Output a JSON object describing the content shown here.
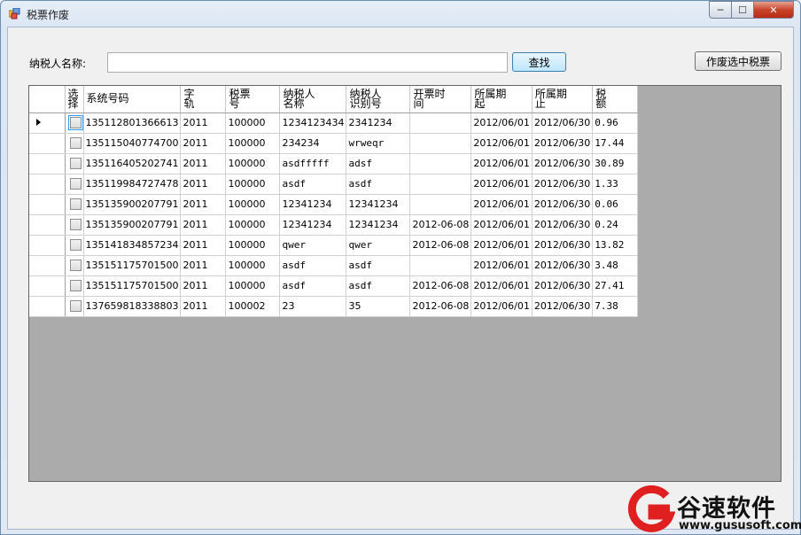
{
  "window": {
    "title": "税票作废",
    "min": "─",
    "max": "☐",
    "close": "✕"
  },
  "search": {
    "label": "纳税人名称:",
    "value": "",
    "find_button": "查找",
    "void_button": "作废选中税票"
  },
  "grid": {
    "columns": [
      {
        "line1": "选",
        "line2": "择"
      },
      {
        "line1": "系统号码",
        "line2": ""
      },
      {
        "line1": "字",
        "line2": "轨"
      },
      {
        "line1": "税票",
        "line2": "号"
      },
      {
        "line1": "纳税人",
        "line2": "名称"
      },
      {
        "line1": "纳税人",
        "line2": "识别号"
      },
      {
        "line1": "开票时",
        "line2": "间"
      },
      {
        "line1": "所属期",
        "line2": "起"
      },
      {
        "line1": "所属期",
        "line2": "止"
      },
      {
        "line1": "税",
        "line2": "额"
      }
    ],
    "rows": [
      [
        "135112801366613",
        "2011",
        "100000",
        "1234123434",
        "2341234",
        "",
        "2012/06/01",
        "2012/06/30",
        "0.96"
      ],
      [
        "135115040774700",
        "2011",
        "100000",
        "234234",
        "wrweqr",
        "",
        "2012/06/01",
        "2012/06/30",
        "17.44"
      ],
      [
        "135116405202741",
        "2011",
        "100000",
        "asdfffff",
        "adsf",
        "",
        "2012/06/01",
        "2012/06/30",
        "30.89"
      ],
      [
        "135119984727478",
        "2011",
        "100000",
        "asdf",
        "asdf",
        "",
        "2012/06/01",
        "2012/06/30",
        "1.33"
      ],
      [
        "135135900207791",
        "2011",
        "100000",
        "12341234",
        "12341234",
        "",
        "2012/06/01",
        "2012/06/30",
        "0.06"
      ],
      [
        "135135900207791",
        "2011",
        "100000",
        "12341234",
        "12341234",
        "2012-06-08",
        "2012/06/01",
        "2012/06/30",
        "0.24"
      ],
      [
        "135141834857234",
        "2011",
        "100000",
        "qwer",
        "qwer",
        "2012-06-08",
        "2012/06/01",
        "2012/06/30",
        "13.82"
      ],
      [
        "135151175701500",
        "2011",
        "100000",
        "asdf",
        "asdf",
        "",
        "2012/06/01",
        "2012/06/30",
        "3.48"
      ],
      [
        "135151175701500",
        "2011",
        "100000",
        "asdf",
        "asdf",
        "2012-06-08",
        "2012/06/01",
        "2012/06/30",
        "27.41"
      ],
      [
        "137659818338803",
        "2011",
        "100002",
        "23",
        "35",
        "2012-06-08",
        "2012/06/01",
        "2012/06/30",
        "7.38"
      ]
    ]
  },
  "watermark": {
    "brand": "谷速软件",
    "url": "www.gususoft.com",
    "color": "#e02020"
  }
}
